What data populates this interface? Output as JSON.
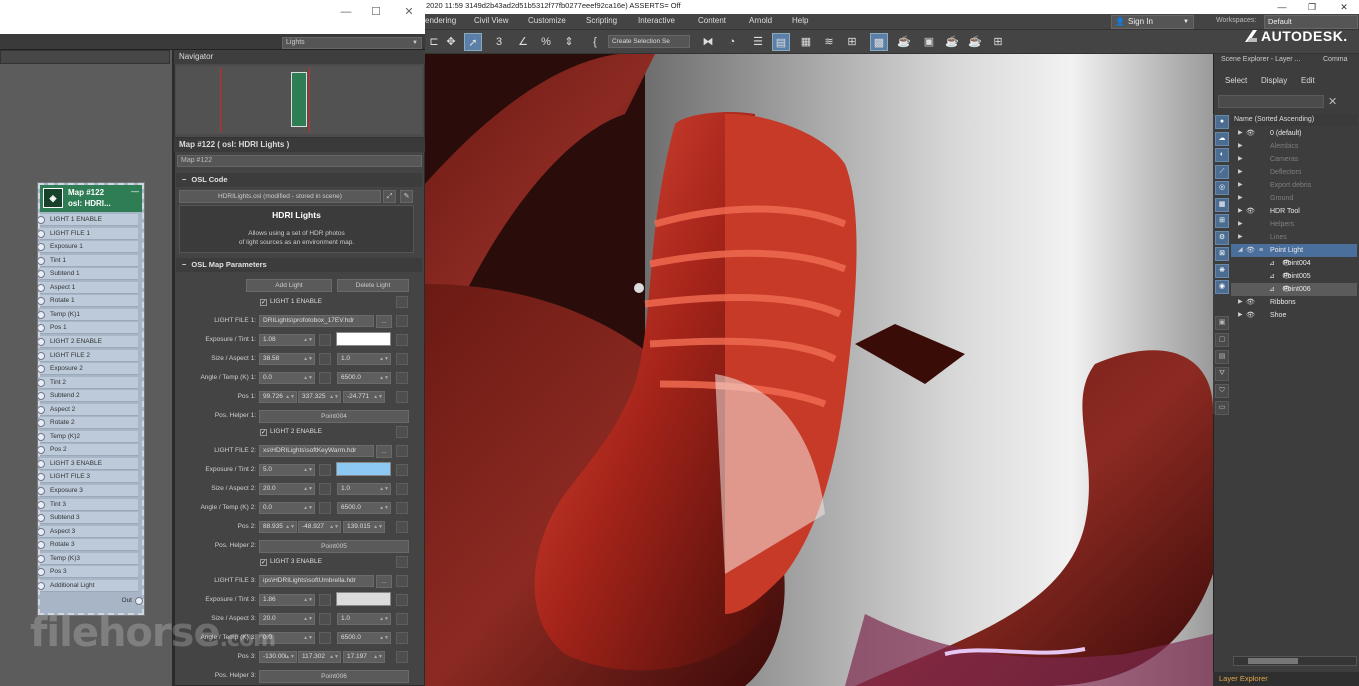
{
  "slate": {
    "view_select": "Lights",
    "navigator_title": "Navigator",
    "node": {
      "title_line1": "Map #122",
      "title_line2": "osl: HDRI...",
      "ports": [
        "LIGHT 1 ENABLE",
        "LIGHT FILE 1",
        "Exposure 1",
        "Tint 1",
        "Subtend 1",
        "Aspect 1",
        "Rotate 1",
        "Temp (K)1",
        "Pos 1",
        "LIGHT 2 ENABLE",
        "LIGHT FILE 2",
        "Exposure 2",
        "Tint 2",
        "Subtend 2",
        "Aspect 2",
        "Rotate 2",
        "Temp (K)2",
        "Pos 2",
        "LIGHT 3 ENABLE",
        "LIGHT FILE 3",
        "Exposure 3",
        "Tint 3",
        "Subtend 3",
        "Aspect 3",
        "Rotate 3",
        "Temp (K)3",
        "Pos 3",
        "Additional Light"
      ],
      "out_label": "Out"
    }
  },
  "params": {
    "panel_title": "Map #122  ( osl: HDRI Lights )",
    "map_name": "Map #122",
    "osl_code_rollout": "OSL Code",
    "osl_file": "HDRILights.osl (modified - stored in scene)",
    "desc_title": "HDRI Lights",
    "desc_line1": "Allows using a set of HDR photos",
    "desc_line2": "of light sources as an environment map.",
    "osl_params_rollout": "OSL Map Parameters",
    "add_light": "Add Light",
    "delete_light": "Delete Light",
    "browse": "...",
    "lights": [
      {
        "enable": "LIGHT 1 ENABLE",
        "file_label": "LIGHT FILE 1:",
        "file": "DRILights\\profotobox_17EV.hdr",
        "exp_label": "Exposure / Tint 1:",
        "exposure": "1.08",
        "tint": "#ffffff",
        "size_label": "Size / Aspect 1:",
        "size": "38.58",
        "aspect": "1.0",
        "angle_label": "Angle / Temp (K) 1:",
        "angle": "0.0",
        "temp": "6500.0",
        "pos_label": "Pos 1:",
        "pos": [
          "99.726",
          "337.325",
          "-24.771"
        ],
        "helper_label": "Pos. Helper 1:",
        "helper": "Point004"
      },
      {
        "enable": "LIGHT 2 ENABLE",
        "file_label": "LIGHT FILE 2:",
        "file": "xs\\HDRILights\\softKeyWarm.hdr",
        "exp_label": "Exposure / Tint 2:",
        "exposure": "5.0",
        "tint": "#8cc8f2",
        "size_label": "Size / Aspect 2:",
        "size": "20.0",
        "aspect": "1.0",
        "angle_label": "Angle / Temp (K) 2:",
        "angle": "0.0",
        "temp": "6500.0",
        "pos_label": "Pos 2:",
        "pos": [
          "88.935",
          "-48.927",
          "139.015"
        ],
        "helper_label": "Pos. Helper 2:",
        "helper": "Point005"
      },
      {
        "enable": "LIGHT 3 ENABLE",
        "file_label": "LIGHT FILE 3:",
        "file": "ips\\HDRILights\\softUmbrella.hdr",
        "exp_label": "Exposure / Tint 3:",
        "exposure": "1.86",
        "tint": "#dcdcdc",
        "size_label": "Size / Aspect 3:",
        "size": "20.0",
        "aspect": "1.0",
        "angle_label": "Angle / Temp (K) 3:",
        "angle": "0.0",
        "temp": "6500.0",
        "pos_label": "Pos 3:",
        "pos": [
          "-130.00i",
          "117.302",
          "17.197"
        ],
        "helper_label": "Pos. Helper 3:",
        "helper": "Point006"
      }
    ]
  },
  "max": {
    "title": "2020 11:59 3149d2b43ad2d51b5312f77fb0277eeef92ca16e) ASSERTS= Off",
    "menus": [
      "endering",
      "Civil View",
      "Customize",
      "Scripting",
      "Interactive",
      "Content",
      "Arnold",
      "Help"
    ],
    "sign_in": "Sign In",
    "workspaces_label": "Workspaces:",
    "workspace": "Default",
    "selection_set": "Create Selection Se",
    "brand": "AUTODESK."
  },
  "explorer": {
    "tab1": "Scene Explorer - Layer ...",
    "tab2": "Comma",
    "menu": [
      "Select",
      "Display",
      "Edit"
    ],
    "column_header": "Name (Sorted Ascending)",
    "rows": [
      "0 (default)",
      "Alembics",
      "Cameras",
      "Deflectors",
      "Export debris",
      "Ground",
      "HDR Tool",
      "Helpers",
      "Lines",
      "Point Light",
      "Point004",
      "Point005",
      "Point006",
      "Ribbons",
      "Shoe"
    ],
    "footer": "Layer Explorer"
  },
  "watermark": "filehorse",
  "watermark_suffix": ".com",
  "colors": {
    "accent": "#4b6f9d",
    "node_header": "#2e7d54",
    "node_body": "#a7b5c7",
    "footer_text": "#e0a74a"
  }
}
